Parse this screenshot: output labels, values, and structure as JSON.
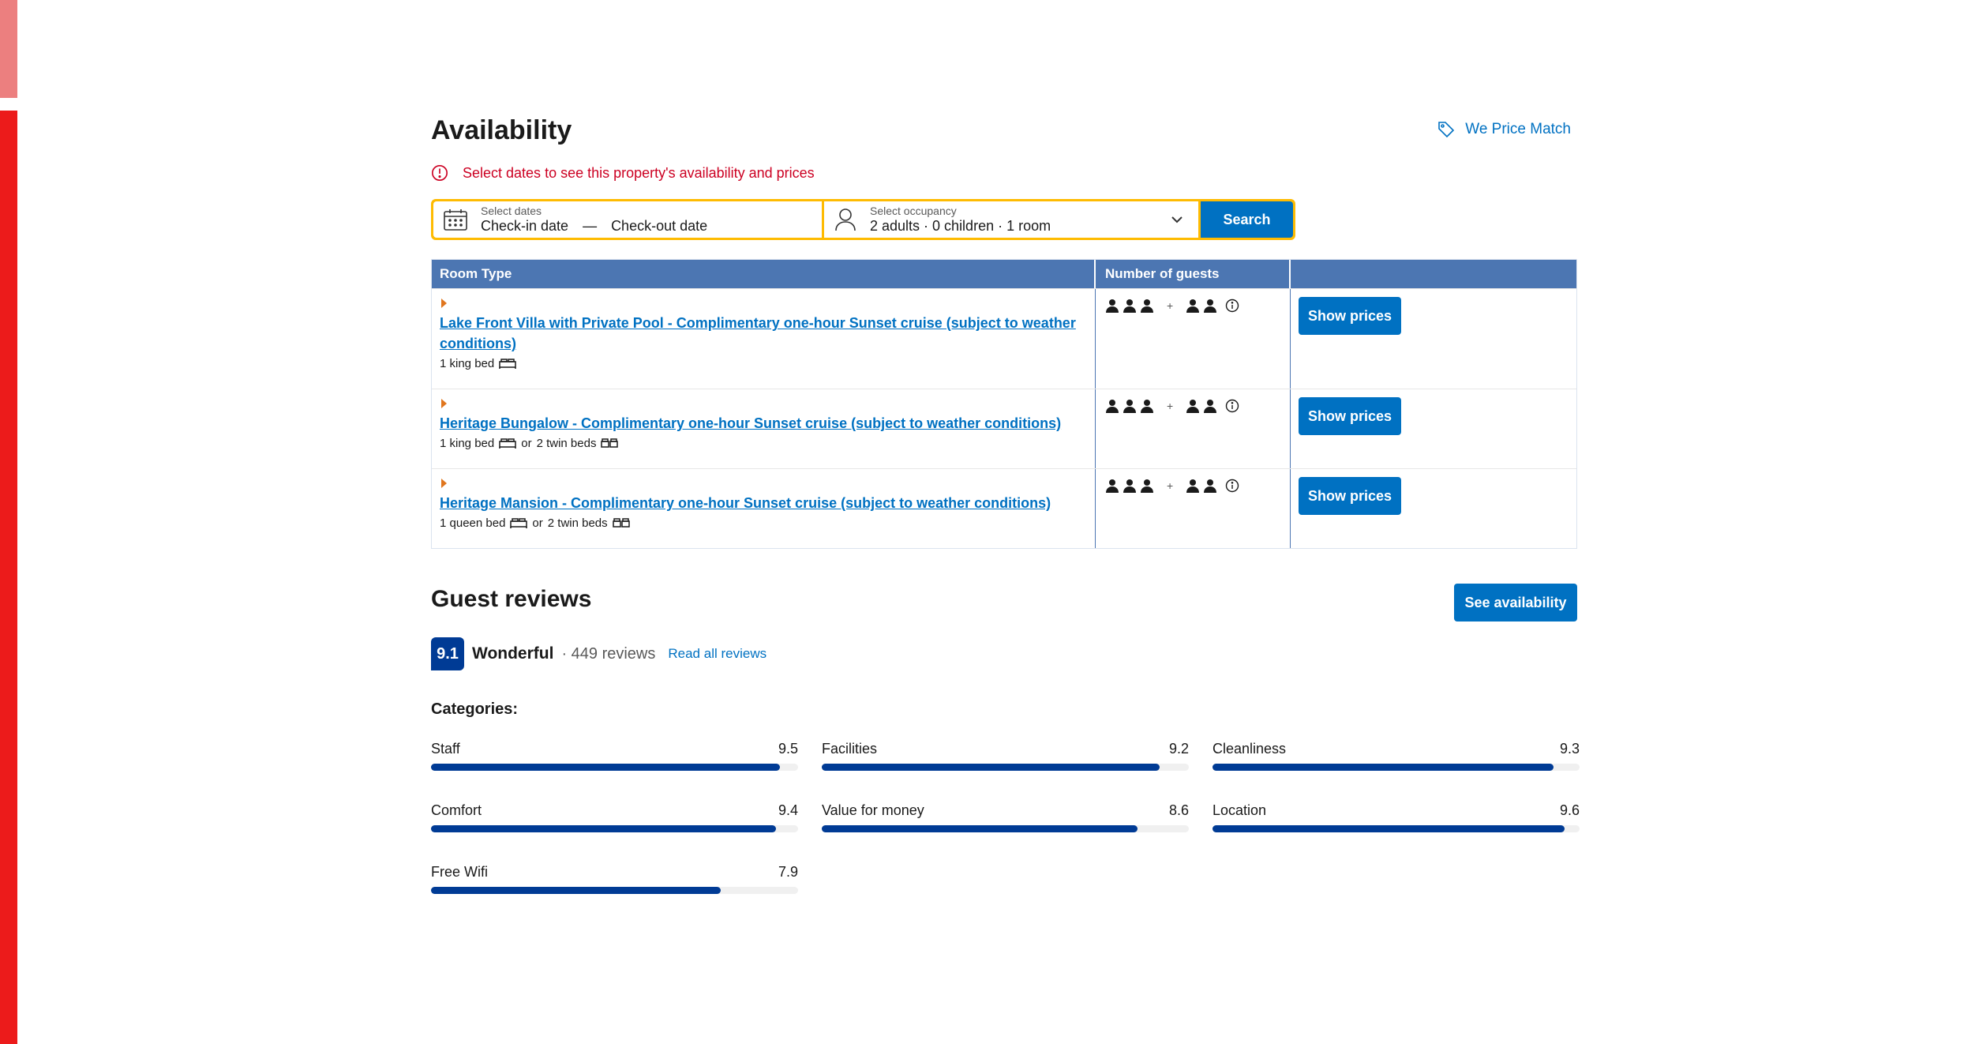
{
  "availability": {
    "title": "Availability",
    "price_match": "We Price Match",
    "alert": "Select dates to see this property's availability and prices"
  },
  "search": {
    "dates_label": "Select dates",
    "checkin": "Check-in date",
    "dash": "—",
    "checkout": "Check-out date",
    "occupancy_label": "Select occupancy",
    "occupancy_value": "2 adults · 0 children · 1 room",
    "button": "Search"
  },
  "table": {
    "headers": [
      "Room Type",
      "Number of guests",
      ""
    ],
    "rows": [
      {
        "name": "Lake Front Villa with Private Pool - Complimentary one-hour Sunset cruise (subject to weather conditions)",
        "bed1": "1 king bed",
        "or": "",
        "bed2": "",
        "adults": 3,
        "children": 2,
        "button": "Show prices"
      },
      {
        "name": "Heritage Bungalow - Complimentary one-hour Sunset cruise (subject to weather conditions)",
        "bed1": "1 king bed",
        "or": "or",
        "bed2": "2 twin beds",
        "adults": 3,
        "children": 2,
        "button": "Show prices"
      },
      {
        "name": "Heritage Mansion - Complimentary one-hour Sunset cruise (subject to weather conditions)",
        "bed1": "1 queen bed",
        "or": "or",
        "bed2": "2 twin beds",
        "adults": 3,
        "children": 2,
        "button": "Show prices"
      }
    ]
  },
  "reviews": {
    "title": "Guest reviews",
    "see_availability": "See availability",
    "score": "9.1",
    "score_word": "Wonderful",
    "count": "· 449 reviews",
    "read_all": "Read all reviews",
    "categories_title": "Categories:",
    "categories": [
      {
        "name": "Staff",
        "score": "9.5",
        "fill": 0.95
      },
      {
        "name": "Facilities",
        "score": "9.2",
        "fill": 0.92
      },
      {
        "name": "Cleanliness",
        "score": "9.3",
        "fill": 0.93
      },
      {
        "name": "Comfort",
        "score": "9.4",
        "fill": 0.94
      },
      {
        "name": "Value for money",
        "score": "8.6",
        "fill": 0.86
      },
      {
        "name": "Location",
        "score": "9.6",
        "fill": 0.96
      },
      {
        "name": "Free Wifi",
        "score": "7.9",
        "fill": 0.79
      }
    ]
  },
  "colors": {
    "brand_blue": "#0071c2",
    "dark_blue": "#003b95",
    "table_header": "#4c76b2",
    "search_border": "#febb02",
    "alert_red": "#cc0022",
    "side_bar": "#ec1b1b"
  }
}
